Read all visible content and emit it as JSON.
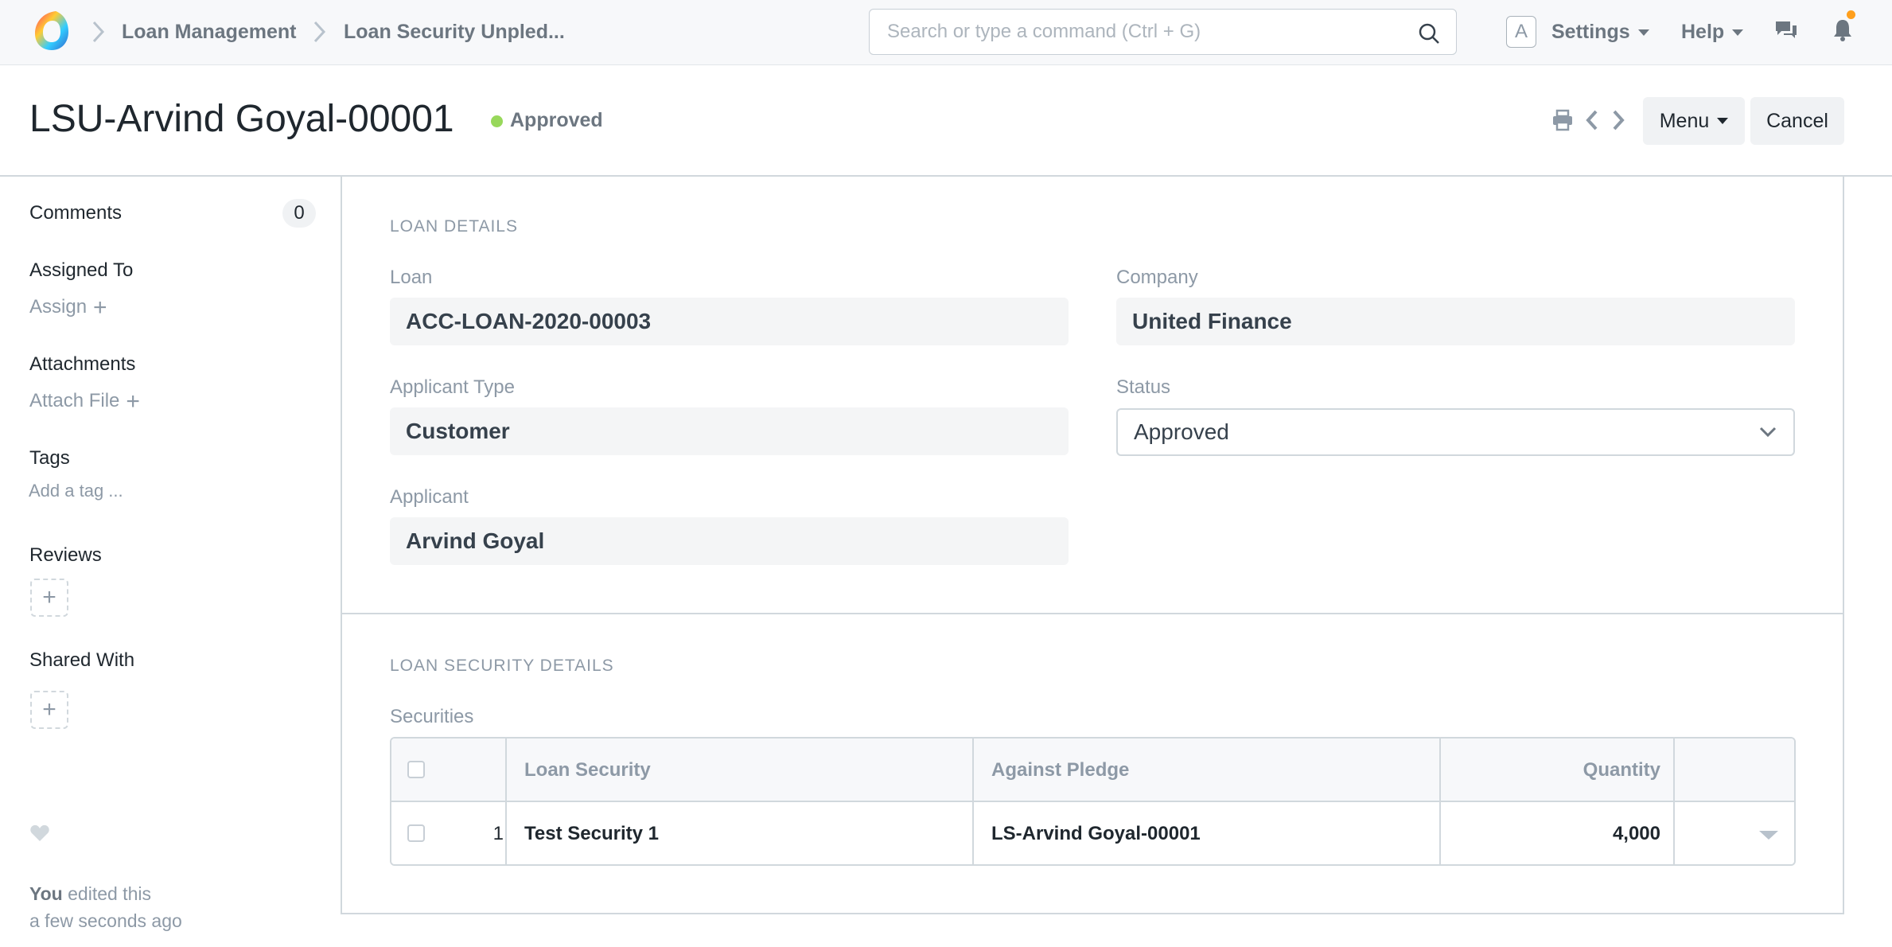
{
  "navbar": {
    "breadcrumbs": [
      "Loan Management",
      "Loan Security Unpled..."
    ],
    "search_placeholder": "Search or type a command (Ctrl + G)",
    "avatar_letter": "A",
    "settings_label": "Settings",
    "help_label": "Help"
  },
  "page": {
    "title": "LSU-Arvind Goyal-00001",
    "status": "Approved",
    "status_color": "#98d85b",
    "menu_label": "Menu",
    "cancel_label": "Cancel"
  },
  "sidebar": {
    "comments_label": "Comments",
    "comments_count": "0",
    "assigned_to_label": "Assigned To",
    "assign_label": "Assign",
    "attachments_label": "Attachments",
    "attach_file_label": "Attach File",
    "tags_label": "Tags",
    "add_tag_label": "Add a tag ...",
    "reviews_label": "Reviews",
    "shared_with_label": "Shared With",
    "edit_actor": "You",
    "edit_action": " edited this",
    "edit_time": "a few seconds ago"
  },
  "loan_details": {
    "section_title": "LOAN DETAILS",
    "loan_label": "Loan",
    "loan_value": "ACC-LOAN-2020-00003",
    "company_label": "Company",
    "company_value": "United Finance",
    "applicant_type_label": "Applicant Type",
    "applicant_type_value": "Customer",
    "status_label": "Status",
    "status_value": "Approved",
    "applicant_label": "Applicant",
    "applicant_value": "Arvind Goyal"
  },
  "security_details": {
    "section_title": "LOAN SECURITY DETAILS",
    "table_label": "Securities",
    "columns": [
      "Loan Security",
      "Against Pledge",
      "Quantity"
    ],
    "rows": [
      {
        "idx": "1",
        "loan_security": "Test Security 1",
        "against_pledge": "LS-Arvind Goyal-00001",
        "quantity": "4,000"
      }
    ]
  },
  "icons": {
    "logo": "app-logo-icon",
    "search": "search-icon",
    "chat": "chat-icon",
    "notifications": "bell-icon",
    "print": "printer-icon",
    "prev": "chevron-left-icon",
    "next": "chevron-right-icon",
    "favorite": "heart-icon"
  }
}
